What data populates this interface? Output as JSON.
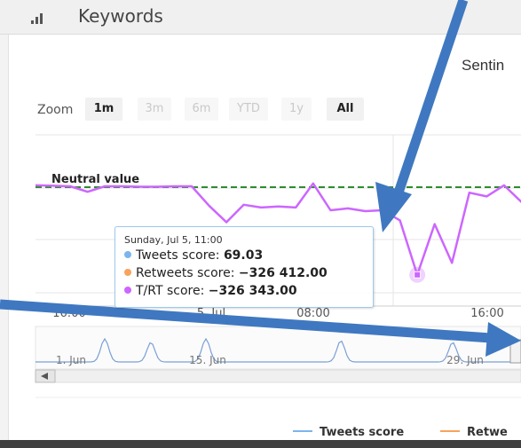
{
  "header": {
    "title": "Keywords",
    "icon": "bar-chart-icon"
  },
  "chart": {
    "title": "Sentin",
    "zoom": {
      "label": "Zoom",
      "buttons": [
        "1m",
        "3m",
        "6m",
        "YTD",
        "1y",
        "All"
      ],
      "active": [
        "1m",
        "All"
      ]
    },
    "annotation": "Neutral value",
    "x_ticks": [
      "16:00",
      "5. Jul",
      "08:00",
      "16:00"
    ],
    "navigator_ticks": [
      "1. Jun",
      "15. Jun",
      "29. Jun"
    ],
    "tooltip": {
      "date": "Sunday, Jul 5, 11:00",
      "rows": [
        {
          "label": "Tweets score:",
          "value": "69.03",
          "color": "#7cb5ec"
        },
        {
          "label": "Retweets score:",
          "value": "−326 412.00",
          "color": "#f7a35c"
        },
        {
          "label": "T/RT score:",
          "value": "−326 343.00",
          "color": "#cc66ff"
        }
      ]
    },
    "legend": [
      {
        "name": "Tweets score",
        "color": "#7cb5ec"
      },
      {
        "name": "Retwe",
        "color": "#f7a35c"
      }
    ]
  },
  "chart_data": {
    "type": "line",
    "series": [
      {
        "name": "T/RT score",
        "color": "#cc66ff",
        "values": [
          0.2,
          0.15,
          0.1,
          -0.5,
          0.1,
          0.1,
          0.05,
          0.05,
          0.1,
          0.1,
          -2.0,
          -3.8,
          -1.9,
          -2.2,
          -2.1,
          -2.2,
          0.4,
          -2.5,
          -2.3,
          -2.6,
          -2.5,
          -3.6,
          -9.5,
          -4.0,
          -8.2,
          -0.6,
          -1.0,
          0.2,
          -1.6,
          -3.5
        ]
      }
    ],
    "reference_line": {
      "label": "Neutral value",
      "value": 0,
      "color": "#2e8b2e"
    },
    "highlight_index": 22
  },
  "colors": {
    "arrow": "#3f78c0",
    "trt": "#cc66ff",
    "tweets": "#7cb5ec",
    "retweets": "#f7a35c",
    "neutral": "#2e8b2e"
  }
}
